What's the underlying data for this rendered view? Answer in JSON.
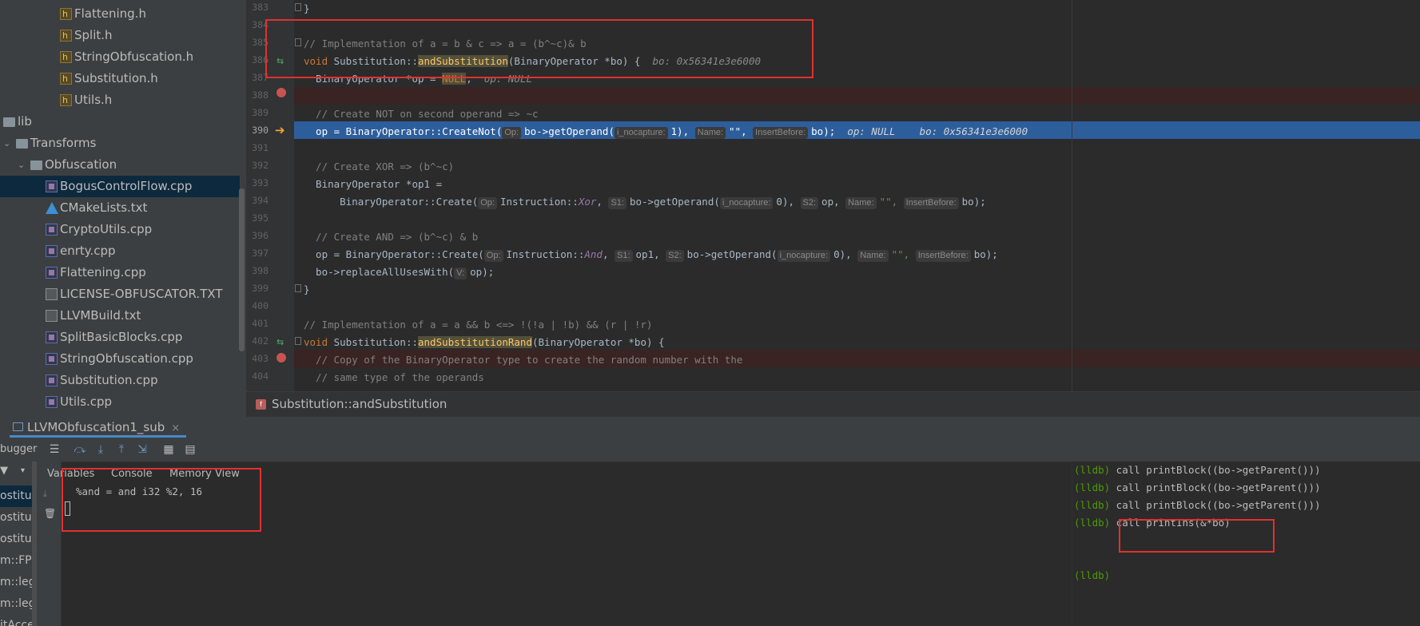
{
  "tree": {
    "items": [
      {
        "label": "Flattening.h",
        "icon": "h-file-icon"
      },
      {
        "label": "Split.h",
        "icon": "h-file-icon"
      },
      {
        "label": "StringObfuscation.h",
        "icon": "h-file-icon"
      },
      {
        "label": "Substitution.h",
        "icon": "h-file-icon"
      },
      {
        "label": "Utils.h",
        "icon": "h-file-icon"
      },
      {
        "label": "lib",
        "icon": "folder-icon"
      },
      {
        "label": "Transforms",
        "icon": "folder-icon"
      },
      {
        "label": "Obfuscation",
        "icon": "folder-icon"
      },
      {
        "label": "BogusControlFlow.cpp",
        "icon": "cpp-file-icon"
      },
      {
        "label": "CMakeLists.txt",
        "icon": "cmake-icon"
      },
      {
        "label": "CryptoUtils.cpp",
        "icon": "cpp-file-icon"
      },
      {
        "label": "enrty.cpp",
        "icon": "cpp-file-icon"
      },
      {
        "label": "Flattening.cpp",
        "icon": "cpp-file-icon"
      },
      {
        "label": "LICENSE-OBFUSCATOR.TXT",
        "icon": "text-file-icon"
      },
      {
        "label": "LLVMBuild.txt",
        "icon": "text-file-icon"
      },
      {
        "label": "SplitBasicBlocks.cpp",
        "icon": "cpp-file-icon"
      },
      {
        "label": "StringObfuscation.cpp",
        "icon": "cpp-file-icon"
      },
      {
        "label": "Substitution.cpp",
        "icon": "cpp-file-icon"
      },
      {
        "label": "Utils.cpp",
        "icon": "cpp-file-icon"
      }
    ]
  },
  "editor": {
    "line_numbers": [
      "383",
      "384",
      "385",
      "386",
      "387",
      "388",
      "389",
      "390",
      "391",
      "392",
      "393",
      "394",
      "395",
      "396",
      "397",
      "398",
      "399",
      "400",
      "401",
      "402",
      "403",
      "404"
    ],
    "code": {
      "l383": "}",
      "l385": "// Implementation of a = b & c => a = (b^~c)& b",
      "l386_kw": "void",
      "l386_cls": " Substitution::",
      "l386_fn": "andSubstitution",
      "l386_rest": "(BinaryOperator *bo) {",
      "l386_dbg": "bo: 0x56341e3e6000",
      "l387_a": "  BinaryOperator *op = ",
      "l387_null": "NULL",
      "l387_b": ";",
      "l387_dbg": "op: NULL",
      "l389": "  // Create NOT on second operand => ~c",
      "l390_a": "  op = BinaryOperator::CreateNot(",
      "l390_h1": "Op:",
      "l390_b": "bo->getOperand(",
      "l390_h2": "i_nocapture:",
      "l390_c": "1), ",
      "l390_h3": "Name:",
      "l390_d": "\"\", ",
      "l390_h4": "InsertBefore:",
      "l390_e": "bo);",
      "l390_dbg1": "op: NULL",
      "l390_dbg2": "bo: 0x56341e3e6000",
      "l392": "  // Create XOR => (b^~c)",
      "l393": "  BinaryOperator *op1 =",
      "l394_a": "      BinaryOperator::Create(",
      "l394_h1": "Op:",
      "l394_b": "Instruction::",
      "l394_it": "Xor",
      "l394_c": ", ",
      "l394_h2": "S1:",
      "l394_d": "bo->getOperand(",
      "l394_h3": "i_nocapture:",
      "l394_e": "0), ",
      "l394_h4": "S2:",
      "l394_f": "op, ",
      "l394_h5": "Name:",
      "l394_g": "\"\", ",
      "l394_h6": "InsertBefore:",
      "l394_h": "bo);",
      "l396": "  // Create AND => (b^~c) & b",
      "l397_a": "  op = BinaryOperator::Create(",
      "l397_h1": "Op:",
      "l397_b": "Instruction::",
      "l397_it": "And",
      "l397_c": ", ",
      "l397_h2": "S1:",
      "l397_d": "op1, ",
      "l397_h3": "S2:",
      "l397_e": "bo->getOperand(",
      "l397_h4": "i_nocapture:",
      "l397_f": "0), ",
      "l397_h5": "Name:",
      "l397_g": "\"\", ",
      "l397_h6": "InsertBefore:",
      "l397_h": "bo);",
      "l398_a": "  bo->replaceAllUsesWith(",
      "l398_h1": "V:",
      "l398_b": "op);",
      "l399": "}",
      "l401": "// Implementation of a = a && b <=> !(!a | !b) && (r | !r)",
      "l402_kw": "void",
      "l402_cls": " Substitution::",
      "l402_fn": "andSubstitutionRand",
      "l402_rest": "(BinaryOperator *bo) {",
      "l403": "  // Copy of the BinaryOperator type to create the random number with the",
      "l404": "  // same type of the operands"
    },
    "breadcrumb": "Substitution::andSubstitution"
  },
  "debug": {
    "tab_label": "LLVMObfuscation1_sub",
    "tab_close": "×",
    "toolbar_label": "bugger",
    "frames": [
      "ostituti",
      "ostituti",
      "ostituti",
      "m::FPP",
      "m::lega",
      "m::lega",
      "itAcces"
    ],
    "subtabs": [
      "Variables",
      "Console",
      "Memory View"
    ],
    "console_output": "%and = and i32 %2, 16",
    "lldb": [
      {
        "prompt": "(lldb)",
        "cmd": " call printBlock((bo->getParent()))"
      },
      {
        "prompt": "(lldb)",
        "cmd": " call printBlock((bo->getParent()))"
      },
      {
        "prompt": "(lldb)",
        "cmd": " call printBlock((bo->getParent()))"
      },
      {
        "prompt": "(lldb)",
        "cmd": " call printIns(&*bo)"
      },
      {
        "prompt": "(lldb)",
        "cmd": ""
      }
    ]
  },
  "colors": {
    "exec_line": "#2d5e9c",
    "highlight_box": "#e0312f"
  }
}
